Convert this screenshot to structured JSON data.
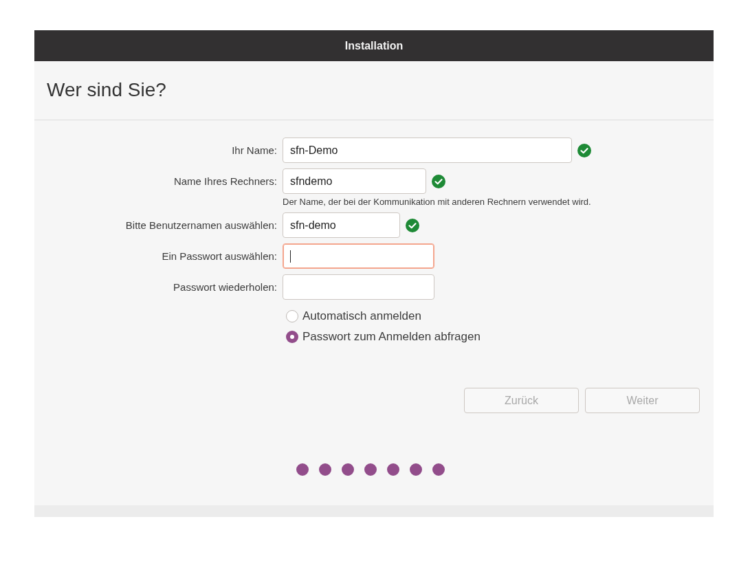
{
  "window": {
    "title": "Installation"
  },
  "heading": "Wer sind Sie?",
  "fields": [
    {
      "label": "Ihr Name:",
      "value": "sfn-Demo",
      "valid": true,
      "focused": false
    },
    {
      "label": "Name Ihres Rechners:",
      "value": "sfndemo",
      "valid": true,
      "focused": false,
      "hint": "Der Name, der bei der Kommunikation mit anderen Rechnern verwendet wird."
    },
    {
      "label": "Bitte Benutzernamen auswählen:",
      "value": "sfn-demo",
      "valid": true,
      "focused": false
    },
    {
      "label": "Ein Passwort auswählen:",
      "valid": false,
      "focused": true
    },
    {
      "label": "Passwort wiederholen:",
      "valid": false,
      "focused": false
    }
  ],
  "login_options": [
    {
      "label": "Automatisch anmelden",
      "selected": false
    },
    {
      "label": "Passwort zum Anmelden abfragen",
      "selected": true
    }
  ],
  "buttons": [
    {
      "label": "Zurück",
      "disabled": true
    },
    {
      "label": "Weiter",
      "disabled": true
    }
  ],
  "progress_dots": [
    {
      "filled": true
    },
    {
      "filled": true
    },
    {
      "filled": true
    },
    {
      "filled": true
    },
    {
      "filled": true
    },
    {
      "filled": true
    },
    {
      "filled": true
    }
  ]
}
